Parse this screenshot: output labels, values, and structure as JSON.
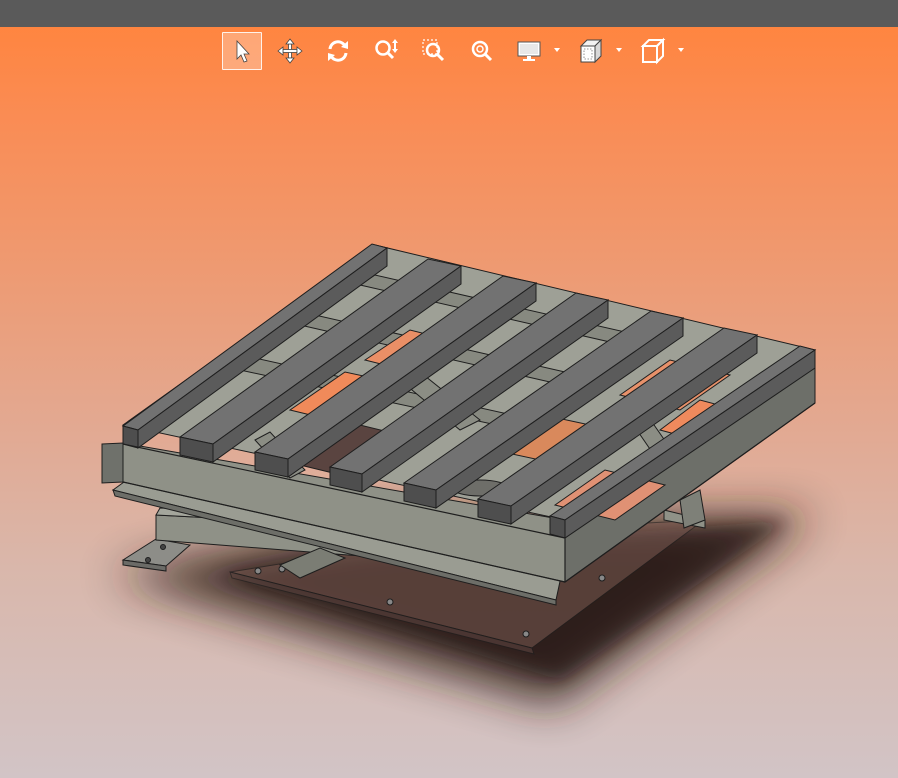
{
  "window": {
    "titlebar_color": "#5a5a5a"
  },
  "viewport": {
    "background_top": "#ff8540",
    "background_bottom": "#d2c4c6",
    "model": {
      "slat_count": 7,
      "body_color": "#8f9187",
      "slat_top_color": "#707070",
      "edge_color": "#1e1e1e"
    }
  },
  "toolbar": {
    "tools": [
      {
        "id": "select",
        "icon": "arrow-pointer-icon",
        "active": true
      },
      {
        "id": "pan",
        "icon": "move-arrows-icon",
        "active": false
      },
      {
        "id": "rotate",
        "icon": "rotate-icon",
        "active": false
      },
      {
        "id": "zoom-in-out",
        "icon": "zoom-in-out-icon",
        "active": false
      },
      {
        "id": "zoom-to-area",
        "icon": "zoom-area-icon",
        "active": false
      },
      {
        "id": "zoom-to-fit",
        "icon": "zoom-fit-icon",
        "active": false
      },
      {
        "id": "display-style",
        "icon": "monitor-icon",
        "has_dropdown": true
      },
      {
        "id": "view-orientation",
        "icon": "view-cube-icon",
        "has_dropdown": true
      },
      {
        "id": "standard-views",
        "icon": "box-outline-icon",
        "has_dropdown": true
      }
    ]
  }
}
